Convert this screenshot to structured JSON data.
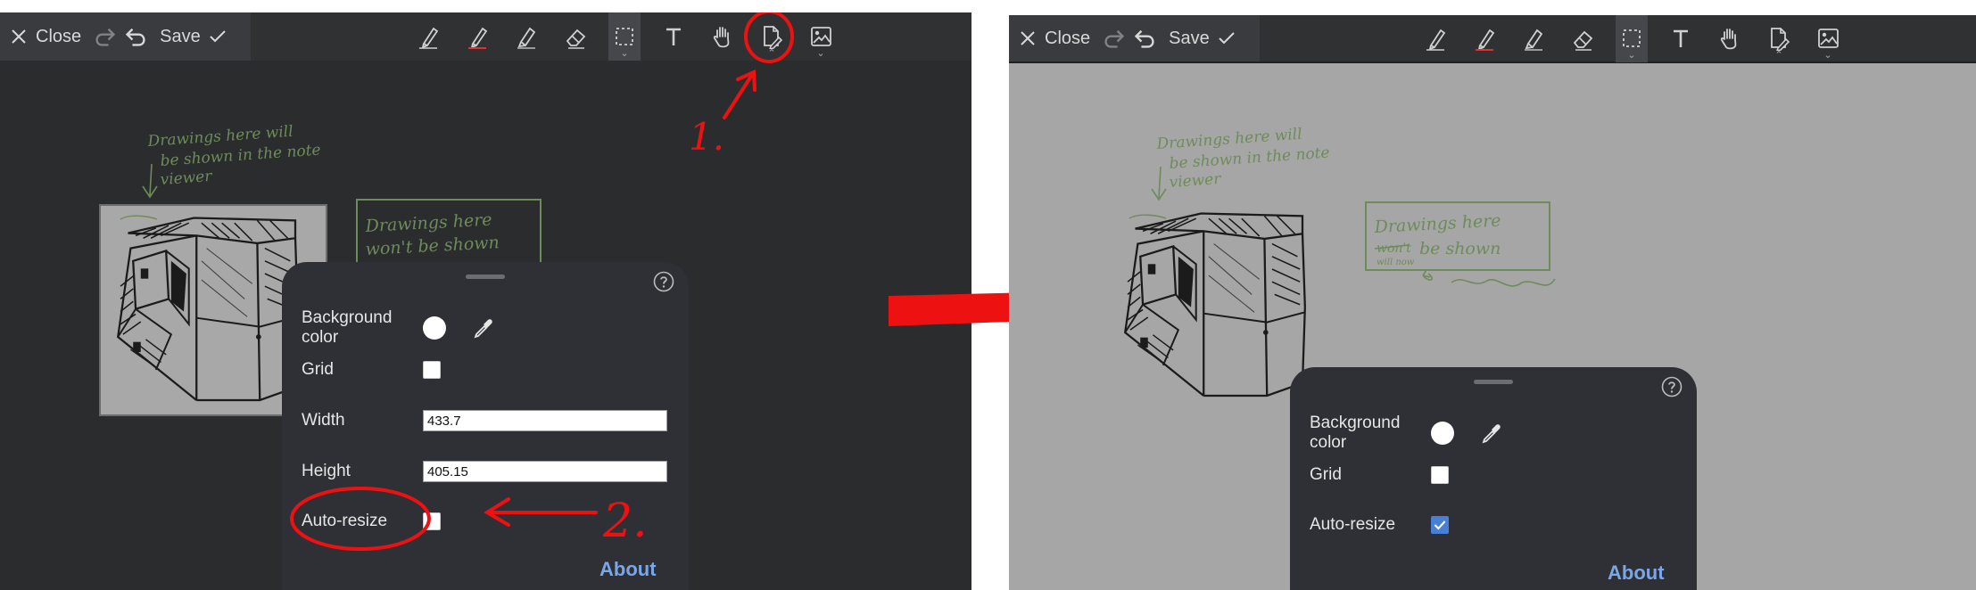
{
  "toolbar": {
    "close_label": "Close",
    "save_label": "Save",
    "tools": [
      {
        "name": "pen-icon"
      },
      {
        "name": "red-pen-icon"
      },
      {
        "name": "highlighter-icon"
      },
      {
        "name": "eraser-icon"
      },
      {
        "name": "selection-icon"
      },
      {
        "name": "text-icon"
      },
      {
        "name": "pan-hand-icon"
      },
      {
        "name": "document-settings-icon"
      },
      {
        "name": "image-icon"
      }
    ]
  },
  "canvas": {
    "note_text_lines": [
      "Drawings here will",
      "be shown in the note",
      "viewer"
    ],
    "box_text_lines": [
      "Drawings here",
      "won't be shown"
    ],
    "right_box_strike": "won't",
    "right_box_small": "will now"
  },
  "panel_left": {
    "background_label": "Background color",
    "grid_label": "Grid",
    "width_label": "Width",
    "width_value": "433.7",
    "height_label": "Height",
    "height_value": "405.15",
    "autoresize_label": "Auto-resize",
    "autoresize_checked": false,
    "about_label": "About"
  },
  "panel_right": {
    "background_label": "Background color",
    "grid_label": "Grid",
    "autoresize_label": "Auto-resize",
    "autoresize_checked": true,
    "about_label": "About"
  },
  "annotations": {
    "step1": "1.",
    "step2": "2."
  },
  "colors": {
    "left_background": "#2b2c2e",
    "right_background": "#a6a6a6",
    "toolbar": "#303133",
    "panel": "#2e3036",
    "annotation_red": "#ee1111",
    "ink_green": "#6f8b5a",
    "about_blue": "#7aa7e8",
    "check_blue": "#4a7fd6"
  }
}
